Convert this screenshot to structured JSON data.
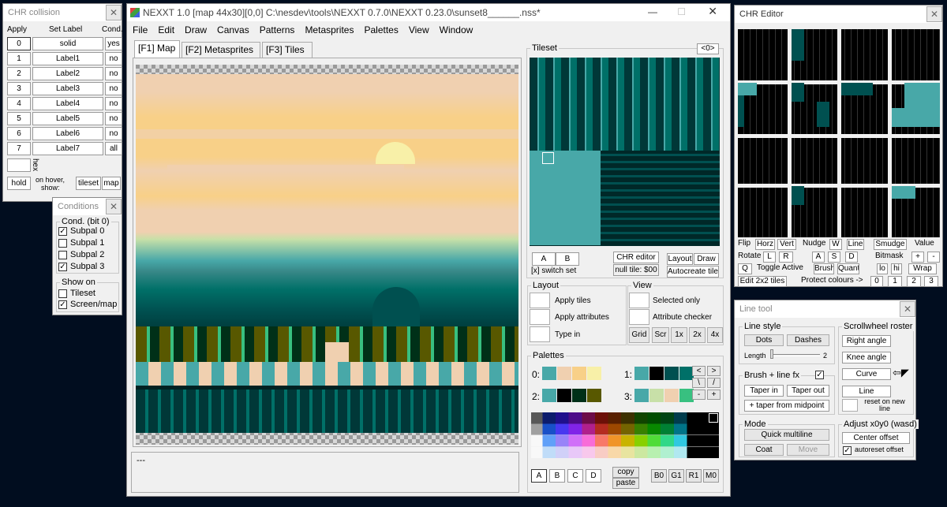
{
  "chr_collision": {
    "title": "CHR collision",
    "headers": [
      "Apply",
      "Set Label",
      "Cond."
    ],
    "rows": [
      {
        "idx": "0",
        "label": "solid",
        "cond": "yes"
      },
      {
        "idx": "1",
        "label": "Label1",
        "cond": "no"
      },
      {
        "idx": "2",
        "label": "Label2",
        "cond": "no"
      },
      {
        "idx": "3",
        "label": "Label3",
        "cond": "no"
      },
      {
        "idx": "4",
        "label": "Label4",
        "cond": "no"
      },
      {
        "idx": "5",
        "label": "Label5",
        "cond": "no"
      },
      {
        "idx": "6",
        "label": "Label6",
        "cond": "no"
      },
      {
        "idx": "7",
        "label": "Label7",
        "cond": "all"
      }
    ],
    "hex_label": "hex",
    "hold": "hold",
    "hover_line1": "on hover,",
    "hover_line2": "show:",
    "tileset": "tileset",
    "map": "map"
  },
  "conditions": {
    "title": "Conditions",
    "cond_group": "Cond. (bit 0)",
    "items": [
      {
        "label": "Subpal 0",
        "checked": "✓"
      },
      {
        "label": "Subpal 1",
        "checked": ""
      },
      {
        "label": "Subpal 2",
        "checked": ""
      },
      {
        "label": "Subpal 3",
        "checked": "✓"
      }
    ],
    "show_on": "Show on",
    "show_items": [
      {
        "label": "Tileset",
        "checked": ""
      },
      {
        "label": "Screen/map",
        "checked": "✓"
      }
    ]
  },
  "main": {
    "title": "NEXXT 1.0  [map 44x30][0,0] C:\\nesdev\\tools\\NEXXT 0.7.0\\NEXXT 0.23.0\\sunset8______.nss*",
    "menu": [
      "File",
      "Edit",
      "Draw",
      "Canvas",
      "Patterns",
      "Metasprites",
      "Palettes",
      "View",
      "Window"
    ],
    "tabs": [
      "[F1] Map",
      "[F2] Metasprites",
      "[F3] Tiles"
    ],
    "status": "---",
    "tileset": {
      "title": "Tileset",
      "nav": "<0>",
      "a": "A",
      "b": "B",
      "switch_set": "[x] switch set",
      "chr_editor": "CHR editor",
      "layout": "Layout",
      "draw": "Draw",
      "null_tile": "null tile: $00",
      "autocreate": "Autocreate tiles"
    },
    "layout": {
      "title": "Layout",
      "apply_tiles": "Apply tiles",
      "apply_attributes": "Apply attributes",
      "type_in": "Type in"
    },
    "view": {
      "title": "View",
      "selected_only": "Selected only",
      "attribute_checker": "Attribute checker",
      "grid": "Grid",
      "scr": "Scr",
      "z1": "1x",
      "z2": "2x",
      "z4": "4x"
    },
    "palettes": {
      "title": "Palettes",
      "sets": [
        {
          "label": "0:",
          "colors": [
            "#48a8a8",
            "#f0d0b0",
            "#f8d088",
            "#f8f0a8"
          ]
        },
        {
          "label": "1:",
          "colors": [
            "#48a8a8",
            "#000000",
            "#005050",
            "#007068"
          ]
        },
        {
          "label": "2:",
          "colors": [
            "#48a8a8",
            "#000000",
            "#003018",
            "#585800"
          ]
        },
        {
          "label": "3:",
          "colors": [
            "#48a8a8",
            "#c8e0a8",
            "#f0d0b0",
            "#38c080"
          ]
        }
      ],
      "arrows": [
        "<",
        ">",
        "\\",
        "/",
        "-",
        "+"
      ],
      "buttons": [
        "A",
        "B",
        "C",
        "D"
      ],
      "copy": "copy",
      "paste": "paste",
      "banks": [
        "B0",
        "G1",
        "R1",
        "M0"
      ]
    }
  },
  "chr_editor": {
    "title": "CHR Editor",
    "row1": [
      "Flip",
      "Horz",
      "Vert",
      "Nudge",
      "W",
      "Line",
      "Smudge",
      "Value"
    ],
    "row2": [
      "Rotate",
      "L",
      "R",
      "A",
      "S",
      "D",
      "Bitmask",
      "+",
      "-"
    ],
    "row3": [
      "Q",
      "Toggle Active",
      "Brush",
      "Quant.",
      "lo",
      "hi",
      "Wrap"
    ],
    "row4": [
      "Edit 2x2 tiles",
      "Protect colours ->",
      "0",
      "1",
      "2",
      "3"
    ]
  },
  "line_tool": {
    "title": "Line tool",
    "line_style": "Line style",
    "dots": "Dots",
    "dashes": "Dashes",
    "length": "Length",
    "length_val": "2",
    "brush_fx": "Brush + line fx",
    "taper_in": "Taper in",
    "taper_out": "Taper out",
    "taper_mid": "+ taper from midpoint",
    "roster": "Scrollwheel roster",
    "right_angle": "Right angle",
    "knee_angle": "Knee angle",
    "curve": "Curve",
    "line": "Line",
    "reset": "reset on new line",
    "mode": "Mode",
    "quick_multiline": "Quick multiline",
    "coat": "Coat",
    "move": "Move",
    "adjust": "Adjust x0y0 (wasd)",
    "center_offset": "Center offset",
    "autoreset": "autoreset offset"
  }
}
